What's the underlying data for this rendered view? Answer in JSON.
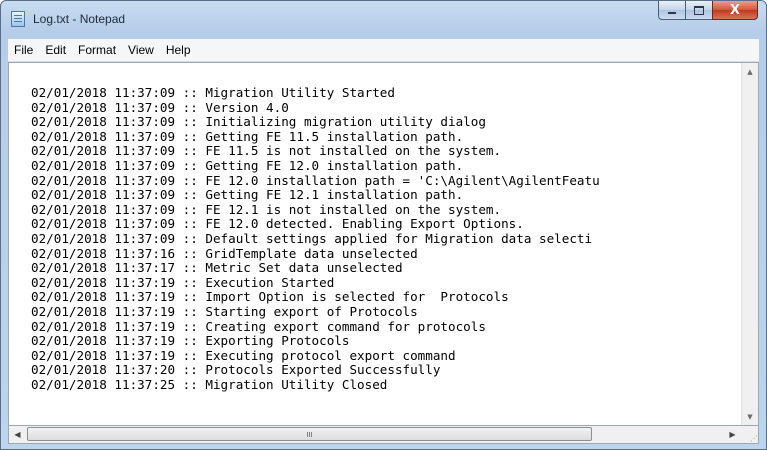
{
  "window": {
    "title": "Log.txt - Notepad"
  },
  "caption_buttons": {
    "close_glyph": "X"
  },
  "menu": [
    "File",
    "Edit",
    "Format",
    "View",
    "Help"
  ],
  "log_lines": [
    "02/01/2018 11:37:09 :: Migration Utility Started",
    "02/01/2018 11:37:09 :: Version 4.0",
    "02/01/2018 11:37:09 :: Initializing migration utility dialog",
    "02/01/2018 11:37:09 :: Getting FE 11.5 installation path.",
    "02/01/2018 11:37:09 :: FE 11.5 is not installed on the system.",
    "02/01/2018 11:37:09 :: Getting FE 12.0 installation path.",
    "02/01/2018 11:37:09 :: FE 12.0 installation path = 'C:\\Agilent\\AgilentFeatu",
    "02/01/2018 11:37:09 :: Getting FE 12.1 installation path.",
    "02/01/2018 11:37:09 :: FE 12.1 is not installed on the system.",
    "02/01/2018 11:37:09 :: FE 12.0 detected. Enabling Export Options.",
    "02/01/2018 11:37:09 :: Default settings applied for Migration data selecti",
    "02/01/2018 11:37:16 :: GridTemplate data unselected",
    "02/01/2018 11:37:17 :: Metric Set data unselected",
    "02/01/2018 11:37:19 :: Execution Started",
    "02/01/2018 11:37:19 :: Import Option is selected for  Protocols",
    "02/01/2018 11:37:19 :: Starting export of Protocols",
    "02/01/2018 11:37:19 :: Creating export command for protocols",
    "02/01/2018 11:37:19 :: Exporting Protocols",
    "02/01/2018 11:37:19 :: Executing protocol export command",
    "02/01/2018 11:37:20 :: Protocols Exported Successfully",
    "02/01/2018 11:37:25 :: Migration Utility Closed"
  ],
  "hscroll": {
    "grip": "III"
  },
  "icons": {
    "app": "notepad-icon",
    "minimize": "minimize-icon",
    "maximize": "maximize-icon",
    "close": "close-icon",
    "scroll_up": "chevron-up-icon",
    "scroll_down": "chevron-down-icon",
    "scroll_left": "chevron-left-icon",
    "scroll_right": "chevron-right-icon"
  },
  "colors": {
    "titlebar": "#c9dcf1",
    "close_button": "#c03a1c",
    "text": "#000000"
  }
}
